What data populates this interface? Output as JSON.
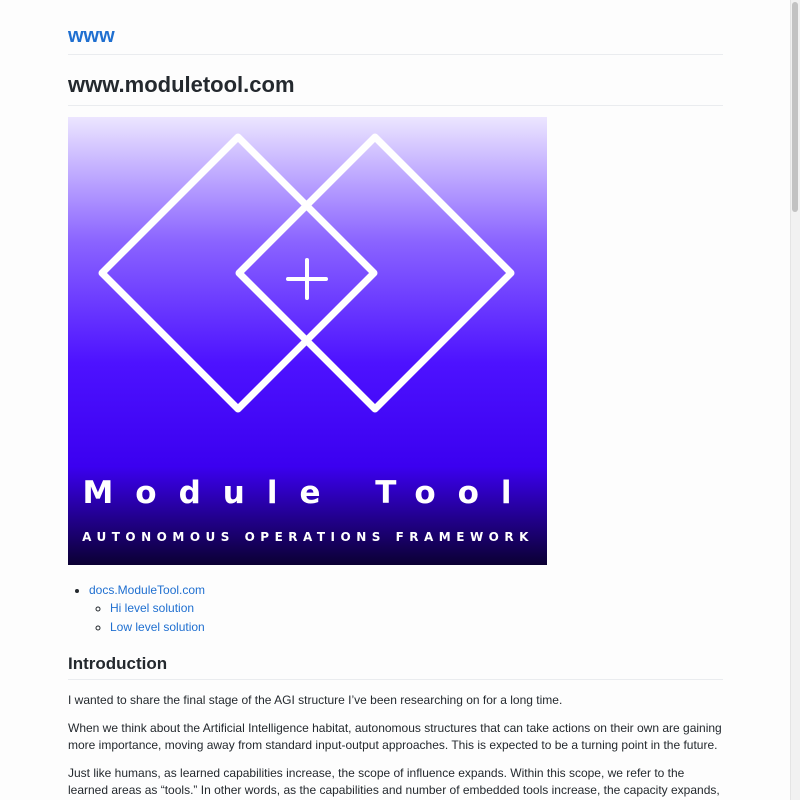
{
  "header": {
    "site_title": "www"
  },
  "page": {
    "title": "www.moduletool.com"
  },
  "hero": {
    "title": "Module Tool",
    "subtitle": "AUTONOMOUS OPERATIONS FRAMEWORK",
    "gradient_colors": [
      "#ece6ff",
      "#8a63ff",
      "#4d12ff",
      "#3b00f0",
      "#0b0033"
    ]
  },
  "toc": {
    "root_label": "docs.ModuleTool.com",
    "children": [
      {
        "label": "Hi level solution"
      },
      {
        "label": "Low level solution"
      }
    ]
  },
  "introduction": {
    "heading": "Introduction",
    "paragraphs": [
      "I wanted to share the final stage of the AGI structure I’ve been researching on for a long time.",
      "When we think about the Artificial Intelligence habitat, autonomous structures that can take actions on their own are gaining more importance, moving away from standard input-output approaches. This is expected to be a turning point in the future.",
      "Just like humans, as learned capabilities increase, the scope of influence expands. Within this scope, we refer to the learned areas as “tools.” In other words, as the capabilities and number of embedded tools increase, the capacity expands, and the standard AI approach evolves towards AGI."
    ]
  },
  "colors": {
    "link": "#1f6fd0",
    "text": "#24292e",
    "divider": "#eaecef"
  }
}
